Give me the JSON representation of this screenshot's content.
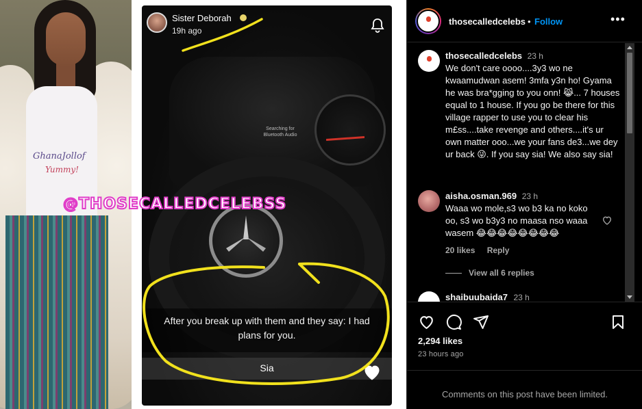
{
  "media": {
    "shirt_line1": "GhanaJollof",
    "shirt_line2": "Yummy!",
    "watermark": "@THOSECALLEDCELEBSS",
    "story": {
      "author": "Sister Deborah",
      "time_ago": "19h ago",
      "dash_screen_text": "Searching for Bluetooth Audio",
      "caption": "After you break up with them and they say: I had plans for you.",
      "reply": "Sia"
    }
  },
  "header": {
    "username": "thosecalledcelebs",
    "separator": "•",
    "follow_label": "Follow",
    "more_label": "•••"
  },
  "caption_comment": {
    "username": "thosecalledcelebs",
    "time": "23 h",
    "text": "We don't care oooo....3y3 wo ne kwaamudwan asem! 3mfa y3n ho! Gyama he was bra*gging to you onn! 😹... 7 houses equal to 1 house. If you go be there for this village rapper to use you to clear his m£ss....take revenge and others....it's ur own matter ooo...we your fans de3...we dey ur back 😜. If you say sia! We also say sia!"
  },
  "comments": [
    {
      "username": "aisha.osman.969",
      "time": "23 h",
      "text": "Waaa wo mole,s3 wo b3 ka no koko oo, s3 wo b3y3 no maasa nso waaa wasem 😂😂😂😂😂😂😂😂",
      "likes": "20 likes",
      "reply_label": "Reply",
      "view_replies": "View all 6 replies"
    },
    {
      "username": "shaibuubaida7",
      "time": "23 h"
    }
  ],
  "post": {
    "likes": "2,294 likes",
    "posted": "23 hours ago",
    "comments_limited": "Comments on this post have been limited."
  },
  "colors": {
    "accent_blue": "#0095f6",
    "watermark_stroke": "#e03cc8",
    "annotation_yellow": "#f1e11d"
  }
}
